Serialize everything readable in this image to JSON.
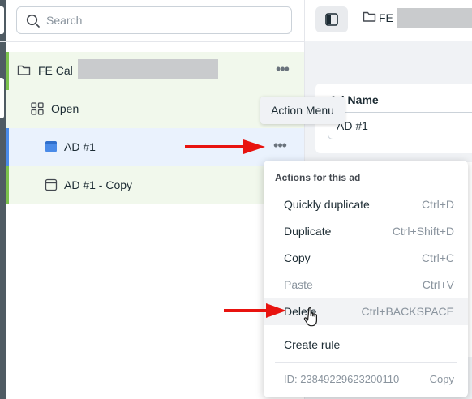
{
  "search": {
    "placeholder": "Search"
  },
  "tree": {
    "campaign_label": "FE Cal",
    "adset_label": "Open",
    "ad_label": "AD #1",
    "ad_copy_label": "AD #1 - Copy",
    "more_glyph": "•••"
  },
  "header": {
    "breadcrumb_label": "FE"
  },
  "editor": {
    "ad_name_label": "Ad Name",
    "ad_name_value": "AD #1"
  },
  "tooltip": {
    "text": "Action Menu"
  },
  "menu": {
    "heading": "Actions for this ad",
    "items": [
      {
        "label": "Quickly duplicate",
        "shortcut": "Ctrl+D",
        "enabled": true
      },
      {
        "label": "Duplicate",
        "shortcut": "Ctrl+Shift+D",
        "enabled": true
      },
      {
        "label": "Copy",
        "shortcut": "Ctrl+C",
        "enabled": true
      },
      {
        "label": "Paste",
        "shortcut": "Ctrl+V",
        "enabled": false
      },
      {
        "label": "Delete",
        "shortcut": "Ctrl+BACKSPACE",
        "enabled": true
      },
      {
        "label": "Create rule",
        "shortcut": "",
        "enabled": true
      }
    ],
    "id_label": "ID: 23849229623200110",
    "copy_label": "Copy"
  },
  "colors": {
    "accent_blue": "#4a8be8",
    "campaign_green": "#7bc24d",
    "annotation_red": "#e8130f"
  },
  "icons": [
    "search-icon",
    "folder-icon",
    "adset-grid-icon",
    "ad-icon",
    "ad-outline-icon",
    "more-icon",
    "panel-toggle-icon",
    "pointer-hand-icon",
    "red-arrow-annotation"
  ]
}
